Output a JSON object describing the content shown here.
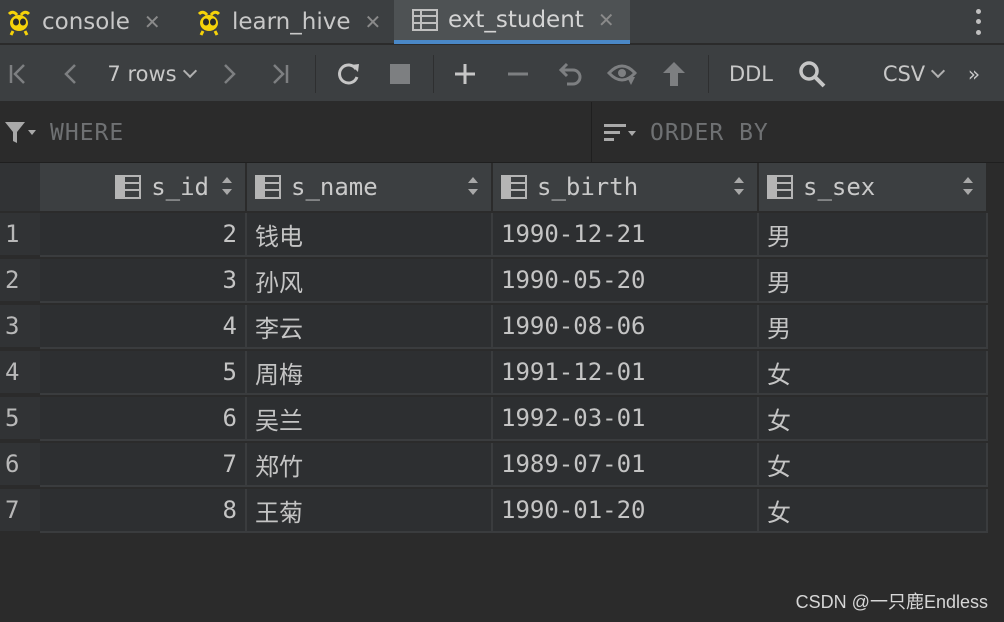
{
  "tabs": [
    {
      "label": "console",
      "icon": "hive-bee-icon",
      "active": false
    },
    {
      "label": "learn_hive",
      "icon": "hive-bee-icon",
      "active": false
    },
    {
      "label": "ext_student",
      "icon": "table-icon",
      "active": true
    }
  ],
  "toolbar": {
    "rows_label": "7 rows",
    "ddl_label": "DDL",
    "export_format": "CSV",
    "more_label": "»"
  },
  "filter": {
    "where_placeholder": "WHERE",
    "order_by_placeholder": "ORDER BY"
  },
  "table": {
    "columns": [
      "s_id",
      "s_name",
      "s_birth",
      "s_sex"
    ],
    "rows": [
      {
        "row_num": "1",
        "s_id": "2",
        "s_name": "钱电",
        "s_birth": "1990-12-21",
        "s_sex": "男"
      },
      {
        "row_num": "2",
        "s_id": "3",
        "s_name": "孙风",
        "s_birth": "1990-05-20",
        "s_sex": "男"
      },
      {
        "row_num": "3",
        "s_id": "4",
        "s_name": "李云",
        "s_birth": "1990-08-06",
        "s_sex": "男"
      },
      {
        "row_num": "4",
        "s_id": "5",
        "s_name": "周梅",
        "s_birth": "1991-12-01",
        "s_sex": "女"
      },
      {
        "row_num": "5",
        "s_id": "6",
        "s_name": "吴兰",
        "s_birth": "1992-03-01",
        "s_sex": "女"
      },
      {
        "row_num": "6",
        "s_id": "7",
        "s_name": "郑竹",
        "s_birth": "1989-07-01",
        "s_sex": "女"
      },
      {
        "row_num": "7",
        "s_id": "8",
        "s_name": "王菊",
        "s_birth": "1990-01-20",
        "s_sex": "女"
      }
    ]
  },
  "watermark": "CSDN @一只鹿Endless",
  "colors": {
    "background": "#2b2b2b",
    "panel": "#3c3f41",
    "active_tab_underline": "#4a88c7",
    "hive_icon_yellow": "#f5d20a"
  }
}
